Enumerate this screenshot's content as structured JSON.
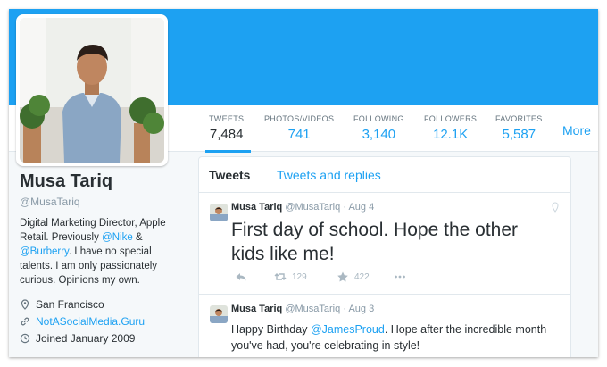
{
  "profile": {
    "name": "Musa Tariq",
    "handle": "@MusaTariq",
    "bio_prefix": "Digital Marketing Director, Apple Retail. Previously ",
    "bio_mention1": "@Nike",
    "bio_amp": " & ",
    "bio_mention2": "@Burberry",
    "bio_suffix": ". I have no special talents. I am only passionately curious. Opinions my own.",
    "location": "San Francisco",
    "website": "NotASocialMedia.Guru",
    "joined": "Joined January 2009"
  },
  "stats": [
    {
      "label": "TWEETS",
      "value": "7,484"
    },
    {
      "label": "PHOTOS/VIDEOS",
      "value": "741"
    },
    {
      "label": "FOLLOWING",
      "value": "3,140"
    },
    {
      "label": "FOLLOWERS",
      "value": "12.1K"
    },
    {
      "label": "FAVORITES",
      "value": "5,587"
    }
  ],
  "more_label": "More",
  "tabs": {
    "tweets": "Tweets",
    "replies": "Tweets and replies"
  },
  "tweets": [
    {
      "name": "Musa Tariq",
      "handle": "@MusaTariq",
      "dot": "·",
      "date": "Aug 4",
      "text": "First day of school. Hope the other kids like me!",
      "retweets": "129",
      "favorites": "422"
    },
    {
      "name": "Musa Tariq",
      "handle": "@MusaTariq",
      "dot": "·",
      "date": "Aug 3",
      "text_prefix": "Happy Birthday ",
      "mention": "@JamesProud",
      "text_suffix": ". Hope after the incredible month you've had, you're celebrating in style!"
    }
  ],
  "colors": {
    "accent": "#1da1f2",
    "text": "#292f33",
    "muted": "#8899a6"
  },
  "icons": [
    "map-pin-icon",
    "link-icon",
    "calendar-icon",
    "reply-icon",
    "retweet-icon",
    "favorite-star-icon",
    "more-dots-icon",
    "location-pin-icon"
  ]
}
